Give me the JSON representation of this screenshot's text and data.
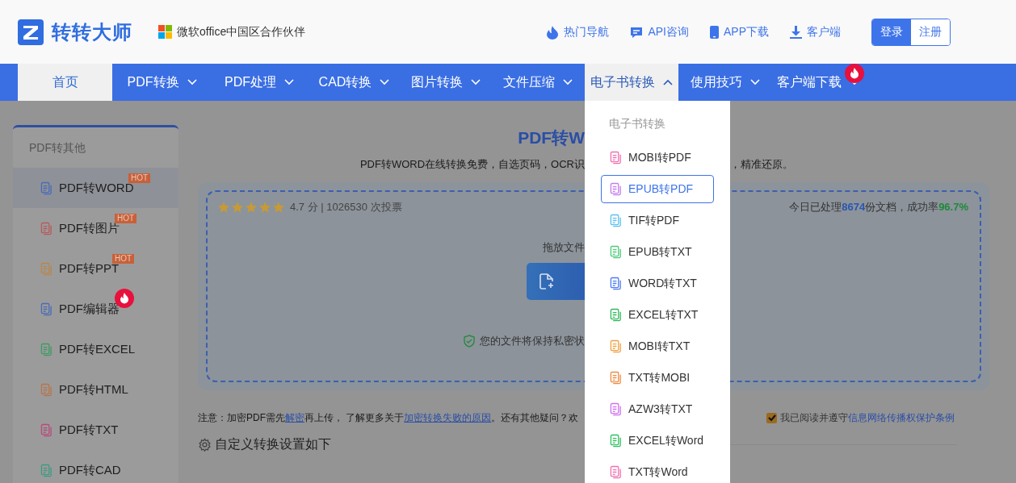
{
  "header": {
    "logo_text": "转转大师",
    "partner": "微软office中国区合作伙伴",
    "links": [
      {
        "label": "热门导航",
        "kind": "flame"
      },
      {
        "label": "API咨询",
        "kind": "chat"
      },
      {
        "label": "APP下载",
        "kind": "phone"
      },
      {
        "label": "客户端",
        "kind": "download"
      }
    ],
    "auth": [
      {
        "label": "登录",
        "selected": true
      },
      {
        "label": "注册",
        "selected": false
      }
    ]
  },
  "nav": [
    {
      "label": "首页",
      "kind": "link",
      "selected": true,
      "expanded": false,
      "hot": false
    },
    {
      "label": "PDF转换",
      "kind": "menu",
      "selected": false,
      "expanded": false,
      "hot": false
    },
    {
      "label": "PDF处理",
      "kind": "menu",
      "selected": false,
      "expanded": false,
      "hot": false
    },
    {
      "label": "CAD转换",
      "kind": "menu",
      "selected": false,
      "expanded": false,
      "hot": false
    },
    {
      "label": "图片转换",
      "kind": "menu",
      "selected": false,
      "expanded": false,
      "hot": false
    },
    {
      "label": "文件压缩",
      "kind": "menu",
      "selected": false,
      "expanded": false,
      "hot": false
    },
    {
      "label": "电子书转换",
      "kind": "menu",
      "selected": false,
      "expanded": true,
      "hot": false
    },
    {
      "label": "使用技巧",
      "kind": "menu",
      "selected": false,
      "expanded": false,
      "hot": false
    },
    {
      "label": "客户端下载",
      "kind": "menu",
      "selected": false,
      "expanded": false,
      "hot": true
    }
  ],
  "dropdown": {
    "heading": "电子书转换",
    "items": [
      {
        "label": "MOBI转PDF",
        "selected": false,
        "color": "#f06fb0"
      },
      {
        "label": "EPUB转PDF",
        "selected": true,
        "color": "#c57bf0"
      },
      {
        "label": "TIF转PDF",
        "selected": false,
        "color": "#5bc0f0"
      },
      {
        "label": "EPUB转TXT",
        "selected": false,
        "color": "#4cc97a"
      },
      {
        "label": "WORD转TXT",
        "selected": false,
        "color": "#4d7cf0"
      },
      {
        "label": "EXCEL转TXT",
        "selected": false,
        "color": "#2fb85a"
      },
      {
        "label": "MOBI转TXT",
        "selected": false,
        "color": "#f0a040"
      },
      {
        "label": "TXT转MOBI",
        "selected": false,
        "color": "#f08a40"
      },
      {
        "label": "AZW3转TXT",
        "selected": false,
        "color": "#d070f0"
      },
      {
        "label": "EXCEL转Word",
        "selected": false,
        "color": "#2fc060"
      },
      {
        "label": "TXT转Word",
        "selected": false,
        "color": "#f070b0"
      }
    ]
  },
  "sidebar": {
    "heading": "PDF转其他",
    "items": [
      {
        "label": "PDF转WORD",
        "selected": true,
        "badge": "HOT",
        "fire": false,
        "color": "#4a6bb8"
      },
      {
        "label": "PDF转图片",
        "selected": false,
        "badge": "HOT",
        "fire": false,
        "color": "#b85a5a"
      },
      {
        "label": "PDF转PPT",
        "selected": false,
        "badge": "HOT",
        "fire": false,
        "color": "#b8864a"
      },
      {
        "label": "PDF编辑器",
        "selected": false,
        "fire": true,
        "color": "#4a6bb8"
      },
      {
        "label": "PDF转EXCEL",
        "selected": false,
        "fire": false,
        "color": "#3f9a63"
      },
      {
        "label": "PDF转HTML",
        "selected": false,
        "fire": false,
        "color": "#b8744a"
      },
      {
        "label": "PDF转TXT",
        "selected": false,
        "fire": false,
        "color": "#b84a7a"
      },
      {
        "label": "PDF转CAD",
        "selected": false,
        "fire": false,
        "color": "#3f9a80"
      }
    ]
  },
  "main": {
    "title": "PDF转W",
    "desc_left": "PDF转WORD在线转换免费，自选页码，OCR识",
    "desc_right": "，精准还原。",
    "rating": {
      "stars": 5,
      "text": "4.7 分 | 1026530 次投票"
    },
    "stats": {
      "prefix": "今日已处理",
      "processed": "8674",
      "middle": "份文档，成功率",
      "rate": "96.7%"
    },
    "drop_hint": "拖放文件",
    "secure": "您的文件将保持私密状",
    "notice": [
      {
        "kind": "text",
        "text": "注意：加密PDF需先"
      },
      {
        "kind": "link",
        "text": "解密"
      },
      {
        "kind": "text",
        "text": "再上传， 了解更多关于"
      },
      {
        "kind": "link",
        "text": "加密转换失败的原因"
      },
      {
        "kind": "text",
        "text": "。还有其他疑问？欢"
      }
    ],
    "consent": {
      "checked": true,
      "text": "我已阅读并遵守",
      "link": "信息网络传播权保护条例"
    },
    "settings": "自定义转换设置如下"
  }
}
